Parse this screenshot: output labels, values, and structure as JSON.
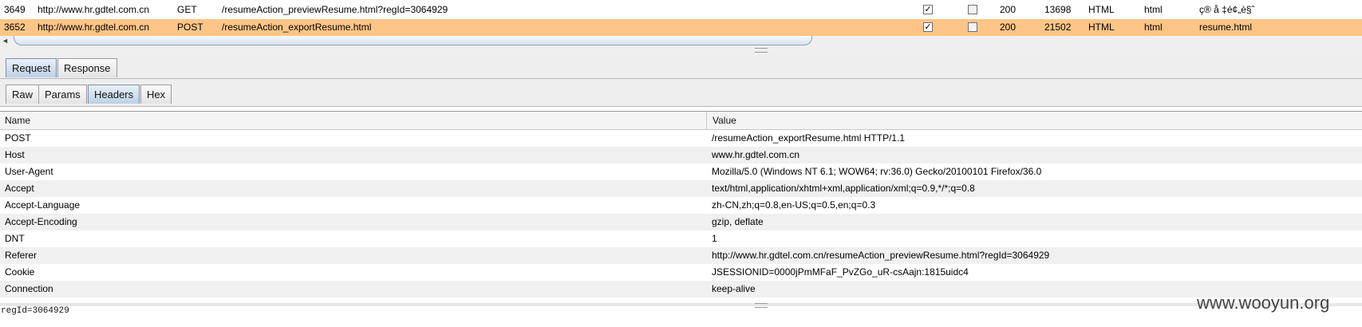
{
  "history": [
    {
      "id": "3649",
      "host": "http://www.hr.gdtel.com.cn",
      "method": "GET",
      "url": "/resumeAction_previewResume.html?regId=3064929",
      "checked1": true,
      "checked2": false,
      "status": "200",
      "length": "13698",
      "mime": "HTML",
      "ext": "html",
      "title": "ç® å ‡é¢„è§ˆ"
    },
    {
      "id": "3652",
      "host": "http://www.hr.gdtel.com.cn",
      "method": "POST",
      "url": "/resumeAction_exportResume.html",
      "checked1": true,
      "checked2": false,
      "status": "200",
      "length": "21502",
      "mime": "HTML",
      "ext": "html",
      "title": "resume.html"
    }
  ],
  "icons": {
    "scroll_left": "◄",
    "checked": "✓"
  },
  "tabs": {
    "top": [
      "Request",
      "Response"
    ],
    "sub": [
      "Raw",
      "Params",
      "Headers",
      "Hex"
    ]
  },
  "headers_table": {
    "columns": [
      "Name",
      "Value"
    ],
    "rows": [
      {
        "name": "POST",
        "value": "/resumeAction_exportResume.html HTTP/1.1"
      },
      {
        "name": "Host",
        "value": "www.hr.gdtel.com.cn"
      },
      {
        "name": "User-Agent",
        "value": "Mozilla/5.0 (Windows NT 6.1; WOW64; rv:36.0) Gecko/20100101 Firefox/36.0"
      },
      {
        "name": "Accept",
        "value": "text/html,application/xhtml+xml,application/xml;q=0.9,*/*;q=0.8"
      },
      {
        "name": "Accept-Language",
        "value": "zh-CN,zh;q=0.8,en-US;q=0.5,en;q=0.3"
      },
      {
        "name": "Accept-Encoding",
        "value": "gzip, deflate"
      },
      {
        "name": "DNT",
        "value": "1"
      },
      {
        "name": "Referer",
        "value": "http://www.hr.gdtel.com.cn/resumeAction_previewResume.html?regId=3064929"
      },
      {
        "name": "Cookie",
        "value": "JSESSIONID=0000jPmMFaF_PvZGo_uR-csAajn:1815uidc4"
      },
      {
        "name": "Connection",
        "value": "keep-alive"
      }
    ]
  },
  "status_text": "regId=3064929",
  "watermark": "www.wooyun.org",
  "colors": {
    "selected_row": "#ffc586",
    "active_tab": "#bcd0e6"
  }
}
